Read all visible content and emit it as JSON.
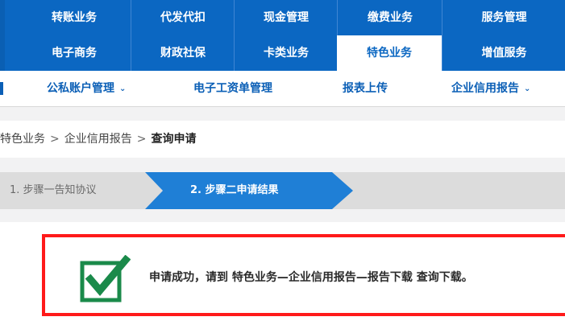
{
  "top_nav": {
    "row1": [
      "转账业务",
      "代发代扣",
      "现金管理",
      "缴费业务",
      "服务管理"
    ],
    "row2": [
      "电子商务",
      "财政社保",
      "卡类业务",
      "特色业务",
      "增值服务"
    ],
    "active": "特色业务"
  },
  "sub_nav": {
    "items": [
      {
        "label": "公私账户管理",
        "has_dropdown": true
      },
      {
        "label": "电子工资单管理",
        "has_dropdown": false
      },
      {
        "label": "报表上传",
        "has_dropdown": false
      },
      {
        "label": "企业信用报告",
        "has_dropdown": true
      }
    ]
  },
  "breadcrumb": {
    "items": [
      "特色业务",
      "企业信用报告"
    ],
    "current": "查询申请",
    "separator": ">"
  },
  "steps": {
    "step1": "1. 步骤一告知协议",
    "step2": "2. 步骤二申请结果"
  },
  "result": {
    "icon": "check-icon",
    "message": "申请成功，请到 特色业务—企业信用报告—报告下载 查询下载。"
  },
  "colors": {
    "nav_blue": "#0b67c2",
    "step_active": "#1f7fd6",
    "highlight_border": "#ff1a1a",
    "check_green": "#1a8a4a"
  }
}
